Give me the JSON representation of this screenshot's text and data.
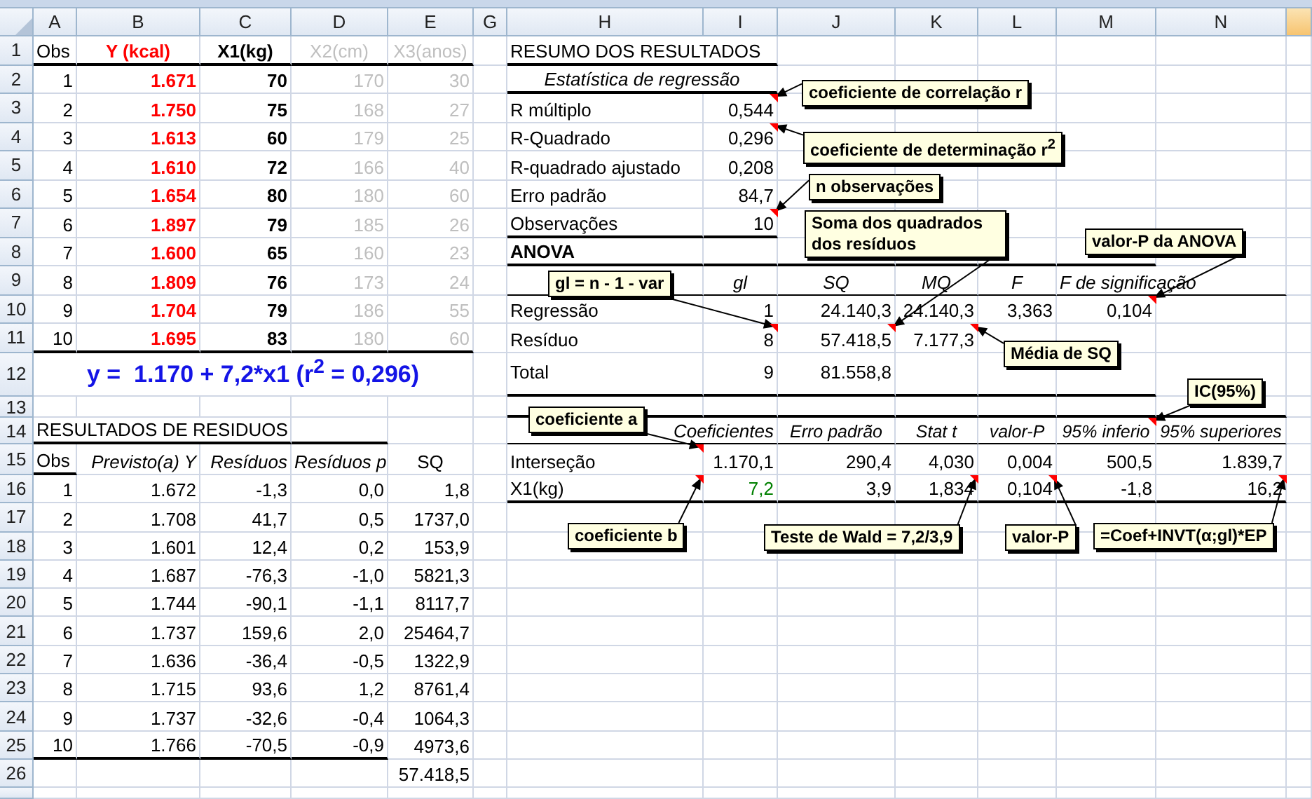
{
  "column_headers": [
    "A",
    "B",
    "C",
    "D",
    "E",
    "G",
    "H",
    "I",
    "J",
    "K",
    "L",
    "M",
    "N"
  ],
  "row_headers": [
    "1",
    "2",
    "3",
    "4",
    "5",
    "6",
    "7",
    "8",
    "9",
    "10",
    "11",
    "12",
    "13",
    "14",
    "15",
    "16",
    "17",
    "18",
    "19",
    "20",
    "21",
    "22",
    "23",
    "24",
    "25",
    "26"
  ],
  "data_table": {
    "columns": [
      {
        "label": "Obs",
        "color": "#000000"
      },
      {
        "label": "Y (kcal)",
        "color": "#ff0000"
      },
      {
        "label": "X1(kg)",
        "color": "#000000"
      },
      {
        "label": "X2(cm)",
        "color": "#bfbfbf"
      },
      {
        "label": "X3(anos)",
        "color": "#bfbfbf"
      }
    ],
    "rows": [
      [
        "1",
        "1.671",
        "70",
        "170",
        "30"
      ],
      [
        "2",
        "1.750",
        "75",
        "168",
        "27"
      ],
      [
        "3",
        "1.613",
        "60",
        "179",
        "25"
      ],
      [
        "4",
        "1.610",
        "72",
        "166",
        "40"
      ],
      [
        "5",
        "1.654",
        "80",
        "180",
        "60"
      ],
      [
        "6",
        "1.897",
        "79",
        "185",
        "26"
      ],
      [
        "7",
        "1.600",
        "65",
        "160",
        "23"
      ],
      [
        "8",
        "1.809",
        "76",
        "173",
        "24"
      ],
      [
        "9",
        "1.704",
        "79",
        "186",
        "55"
      ],
      [
        "10",
        "1.695",
        "83",
        "180",
        "60"
      ]
    ]
  },
  "equation": "y =  1.170 + 7,2*x1 (r$^{2}$ = 0,296)",
  "residuals": {
    "title": "RESULTADOS DE RESIDUOS",
    "columns": [
      "Obs",
      "Previsto(a) Y",
      "Resíduos",
      "Resíduos p",
      "SQ"
    ],
    "rows": [
      [
        "1",
        "1.672",
        "-1,3",
        "0,0",
        "1,8"
      ],
      [
        "2",
        "1.708",
        "41,7",
        "0,5",
        "1737,0"
      ],
      [
        "3",
        "1.601",
        "12,4",
        "0,2",
        "153,9"
      ],
      [
        "4",
        "1.687",
        "-76,3",
        "-1,0",
        "5821,3"
      ],
      [
        "5",
        "1.744",
        "-90,1",
        "-1,1",
        "8117,7"
      ],
      [
        "6",
        "1.737",
        "159,6",
        "2,0",
        "25464,7"
      ],
      [
        "7",
        "1.636",
        "-36,4",
        "-0,5",
        "1322,9"
      ],
      [
        "8",
        "1.715",
        "93,6",
        "1,2",
        "8761,4"
      ],
      [
        "9",
        "1.737",
        "-32,6",
        "-0,4",
        "1064,3"
      ],
      [
        "10",
        "1.766",
        "-70,5",
        "-0,9",
        "4973,6"
      ]
    ],
    "total": "57.418,5"
  },
  "summary": {
    "title": "RESUMO DOS RESULTADOS",
    "regression_title": "Estatística de regressão",
    "statistics": [
      {
        "label": "R múltiplo",
        "value": "0,544"
      },
      {
        "label": "R-Quadrado",
        "value": "0,296"
      },
      {
        "label": "R-quadrado ajustado",
        "value": "0,208"
      },
      {
        "label": "Erro padrão",
        "value": "84,7"
      },
      {
        "label": "Observações",
        "value": "10"
      }
    ],
    "anova": {
      "title": "ANOVA",
      "columns": [
        "gl",
        "SQ",
        "MQ",
        "F",
        "F de significação"
      ],
      "rows": [
        {
          "label": "Regressão",
          "values": [
            "1",
            "24.140,3",
            "24.140,3",
            "3,363",
            "0,104"
          ]
        },
        {
          "label": "Resíduo",
          "values": [
            "8",
            "57.418,5",
            "7.177,3"
          ]
        },
        {
          "label": "Total",
          "values": [
            "9",
            "81.558,8"
          ]
        }
      ]
    },
    "coefficients": {
      "columns": [
        "Coeficientes",
        "Erro padrão",
        "Stat t",
        "valor-P",
        "95% inferio",
        "95% superiores"
      ],
      "rows": [
        {
          "label": "Interseção",
          "color": "#000000",
          "values": [
            "1.170,1",
            "290,4",
            "4,030",
            "0,004",
            "500,5",
            "1.839,7"
          ]
        },
        {
          "label": "X1(kg)",
          "color": "#008000",
          "values": [
            "7,2",
            "3,9",
            "1,834",
            "0,104",
            "-1,8",
            "16,2"
          ]
        }
      ]
    }
  },
  "callouts": [
    {
      "text": "coeficiente de correlação r"
    },
    {
      "text": "coeficiente de determinação r$^{2}$"
    },
    {
      "text": "n observações"
    },
    {
      "text": "Soma dos quadrados dos resíduos"
    },
    {
      "text": "valor-P da ANOVA"
    },
    {
      "text": "gl = n - 1 - var"
    },
    {
      "text": "Média de SQ"
    },
    {
      "text": "IC(95%)"
    },
    {
      "text": "coeficiente a"
    },
    {
      "text": "coeficiente b"
    },
    {
      "text": "Teste de Wald = 7,2/3,9"
    },
    {
      "text": "valor-P"
    },
    {
      "text": "=Coef+INVT(α;gl)*EP"
    }
  ]
}
